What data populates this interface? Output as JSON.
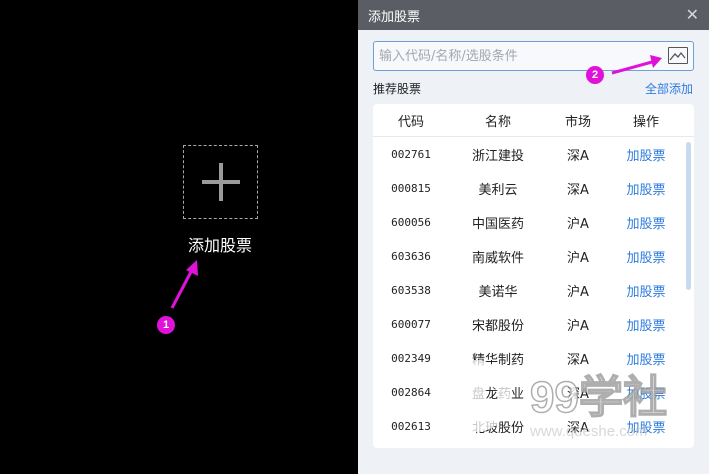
{
  "left": {
    "add_label": "添加股票"
  },
  "badges": {
    "one": "1",
    "two": "2"
  },
  "dialog": {
    "title": "添加股票",
    "search_placeholder": "输入代码/名称/选股条件",
    "recommended_title": "推荐股票",
    "add_all": "全部添加",
    "columns": [
      "代码",
      "名称",
      "市场",
      "操作"
    ],
    "rows": [
      {
        "code": "002761",
        "name": "浙江建投",
        "market": "深A",
        "action": "加股票"
      },
      {
        "code": "000815",
        "name": "美利云",
        "market": "深A",
        "action": "加股票"
      },
      {
        "code": "600056",
        "name": "中国医药",
        "market": "沪A",
        "action": "加股票"
      },
      {
        "code": "603636",
        "name": "南威软件",
        "market": "沪A",
        "action": "加股票"
      },
      {
        "code": "603538",
        "name": "美诺华",
        "market": "沪A",
        "action": "加股票"
      },
      {
        "code": "600077",
        "name": "宋都股份",
        "market": "沪A",
        "action": "加股票"
      },
      {
        "code": "002349",
        "name": "精华制药",
        "market": "深A",
        "action": "加股票"
      },
      {
        "code": "002864",
        "name": "盘龙药业",
        "market": "深A",
        "action": "加股票"
      },
      {
        "code": "002613",
        "name": "北玻股份",
        "market": "深A",
        "action": "加股票"
      }
    ]
  },
  "watermark": {
    "brand": "99学社",
    "url": "www.queshe.com"
  },
  "colors": {
    "accent": "#2e7be0",
    "badge": "#e011d9",
    "titlebar": "#5a5d63"
  }
}
